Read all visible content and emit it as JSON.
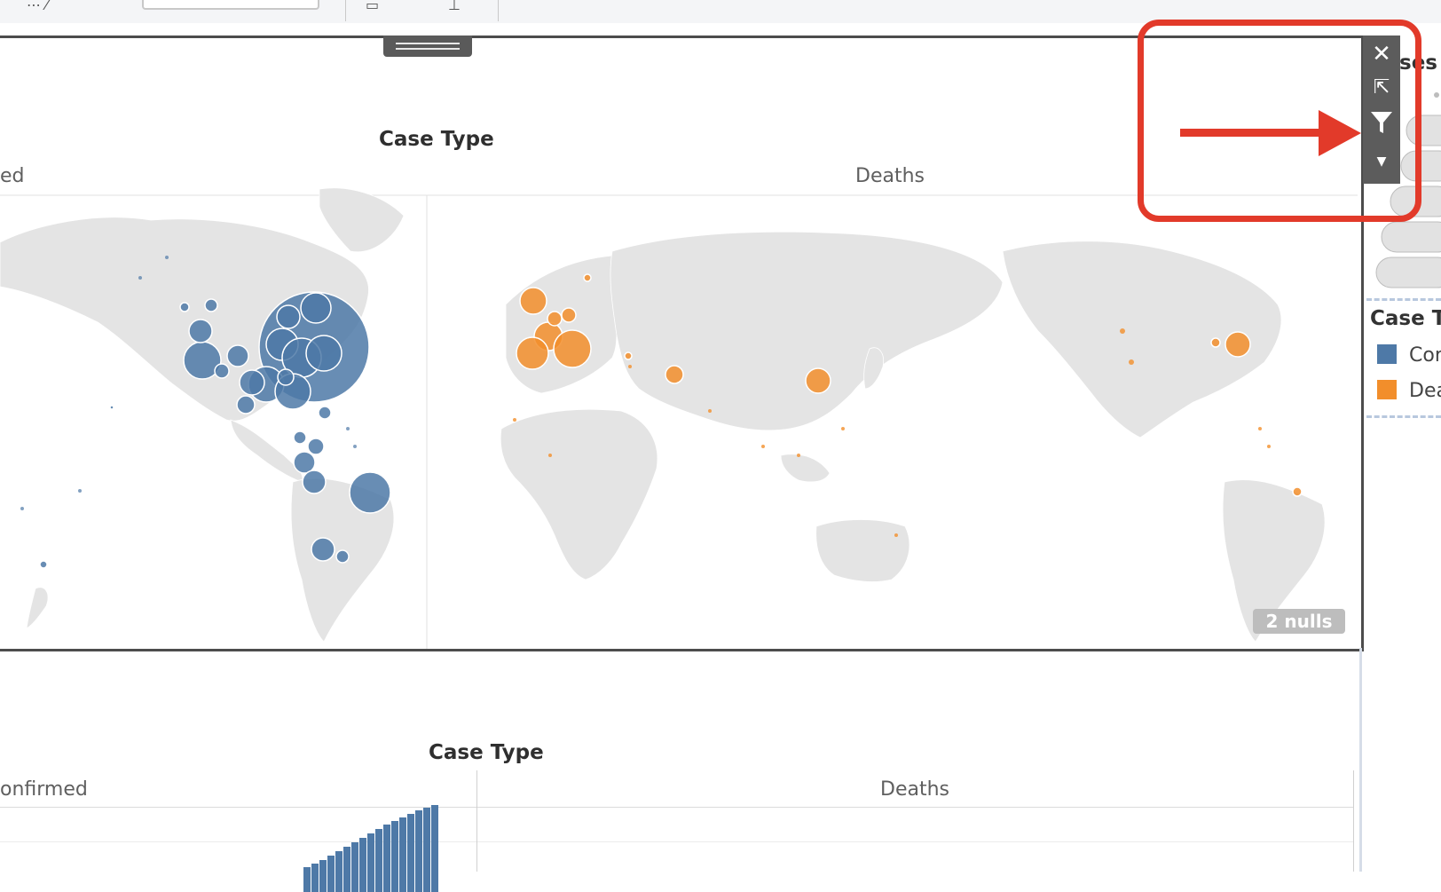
{
  "toolbar": {
    "items": [
      "tb-left",
      "tb-right"
    ]
  },
  "map_view": {
    "title": "Case Type",
    "columns": [
      {
        "label": "ed",
        "color": "#4e79a7"
      },
      {
        "label": "Deaths",
        "color": "#f28e2b"
      }
    ],
    "nulls_badge": "2 nulls"
  },
  "controls": {
    "close": "close",
    "popout": "pop out",
    "filter": "filter",
    "menu": "more options"
  },
  "right_panel": {
    "partial_title": "ses",
    "legend_title": "Case Ty",
    "legend_items": [
      {
        "label": "Cor",
        "color": "#4e79a7"
      },
      {
        "label": "Dea",
        "color": "#f28e2b"
      }
    ]
  },
  "bar_view": {
    "title": "Case Type",
    "columns": [
      {
        "label": "onfirmed"
      },
      {
        "label": "Deaths"
      }
    ]
  }
}
